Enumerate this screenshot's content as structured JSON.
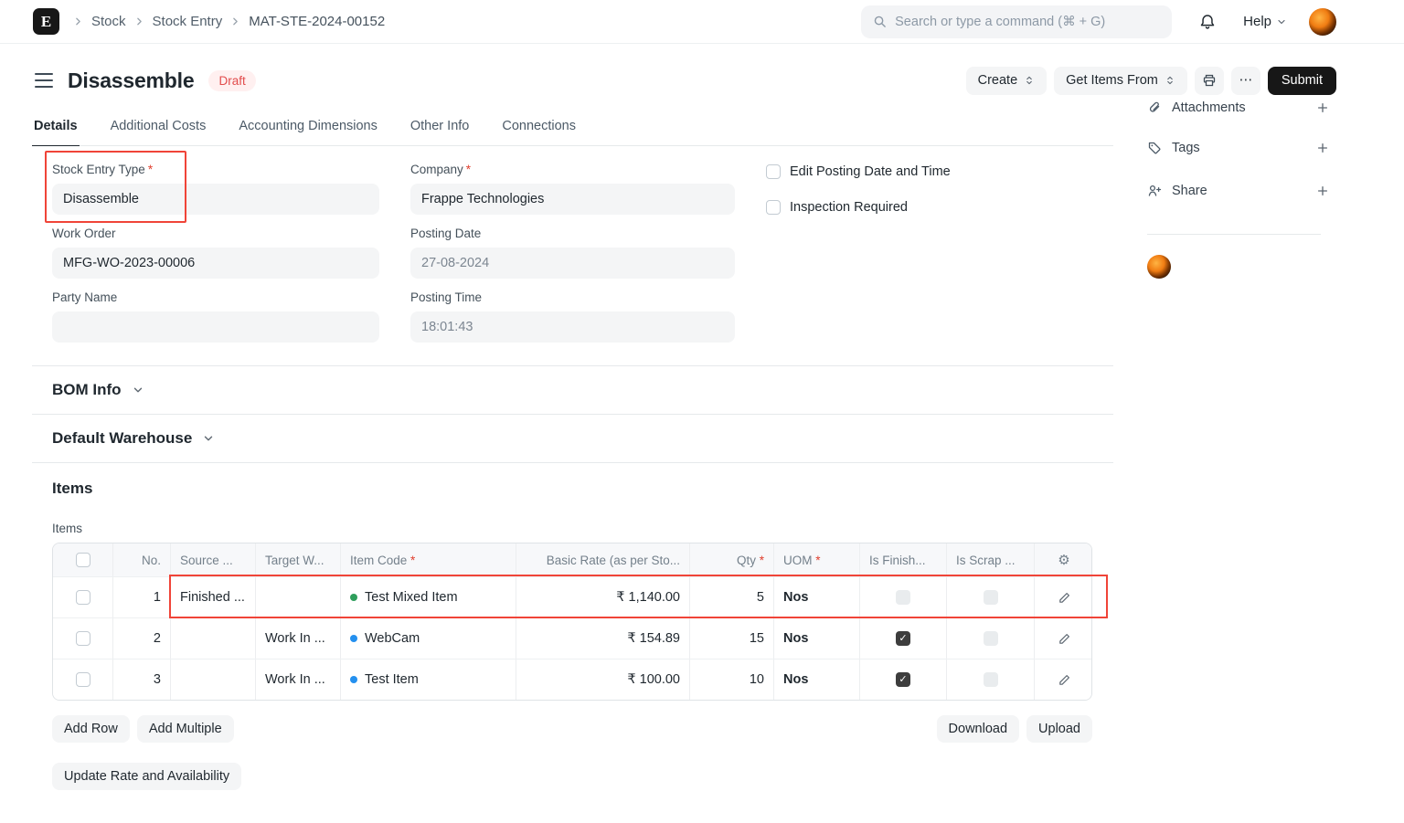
{
  "colors": {
    "annotation_red": "#f04438",
    "required_red": "#e03e2d",
    "draft_text": "#e24c4c",
    "draft_bg": "#fff0f0",
    "submit_bg": "#171717",
    "item_dot_green": "#2e9e5b",
    "item_dot_blue": "#2490ef"
  },
  "navbar": {
    "logo_letter": "E",
    "breadcrumbs": [
      "Stock",
      "Stock Entry",
      "MAT-STE-2024-00152"
    ],
    "search_placeholder": "Search or type a command (⌘ + G)",
    "help_label": "Help"
  },
  "header": {
    "title": "Disassemble",
    "status": "Draft",
    "create_button": "Create",
    "get_items_from_button": "Get Items From",
    "more_button": "⋯",
    "submit_button": "Submit"
  },
  "tabs": [
    {
      "label": "Details",
      "active": true
    },
    {
      "label": "Additional Costs",
      "active": false
    },
    {
      "label": "Accounting Dimensions",
      "active": false
    },
    {
      "label": "Other Info",
      "active": false
    },
    {
      "label": "Connections",
      "active": false
    }
  ],
  "form": {
    "stock_entry_type": {
      "label": "Stock Entry Type",
      "required": true,
      "value": "Disassemble"
    },
    "work_order": {
      "label": "Work Order",
      "value": "MFG-WO-2023-00006"
    },
    "party_name": {
      "label": "Party Name",
      "value": ""
    },
    "company": {
      "label": "Company",
      "required": true,
      "value": "Frappe Technologies"
    },
    "posting_date": {
      "label": "Posting Date",
      "value": "27-08-2024"
    },
    "posting_time": {
      "label": "Posting Time",
      "value": "18:01:43"
    },
    "edit_posting_checkbox": {
      "label": "Edit Posting Date and Time",
      "checked": false
    },
    "inspection_checkbox": {
      "label": "Inspection Required",
      "checked": false
    }
  },
  "sections": {
    "bom_info": "BOM Info",
    "default_warehouse": "Default Warehouse",
    "items_heading": "Items",
    "items_field_label": "Items"
  },
  "items_table": {
    "columns": [
      {
        "label": "No.",
        "required": false
      },
      {
        "label": "Source ...",
        "required": false
      },
      {
        "label": "Target W...",
        "required": false
      },
      {
        "label": "Item Code",
        "required": true
      },
      {
        "label": "Basic Rate (as per Sto...",
        "required": false
      },
      {
        "label": "Qty",
        "required": true
      },
      {
        "label": "UOM",
        "required": true
      },
      {
        "label": "Is Finish...",
        "required": false
      },
      {
        "label": "Is Scrap ...",
        "required": false
      }
    ],
    "rows": [
      {
        "no": "1",
        "source_warehouse": "Finished ...",
        "target_warehouse": "",
        "item_code": "Test Mixed Item",
        "dot": "green",
        "basic_rate": "₹ 1,140.00",
        "qty": "5",
        "uom": "Nos",
        "is_finished_item": false,
        "is_scrap_item": false,
        "highlighted": true
      },
      {
        "no": "2",
        "source_warehouse": "",
        "target_warehouse": "Work In ...",
        "item_code": "WebCam",
        "dot": "blue",
        "basic_rate": "₹ 154.89",
        "qty": "15",
        "uom": "Nos",
        "is_finished_item": true,
        "is_scrap_item": false,
        "highlighted": false
      },
      {
        "no": "3",
        "source_warehouse": "",
        "target_warehouse": "Work In ...",
        "item_code": "Test Item",
        "dot": "blue",
        "basic_rate": "₹ 100.00",
        "qty": "10",
        "uom": "Nos",
        "is_finished_item": true,
        "is_scrap_item": false,
        "highlighted": false
      }
    ]
  },
  "table_buttons": {
    "add_row": "Add Row",
    "add_multiple": "Add Multiple",
    "download": "Download",
    "upload": "Upload"
  },
  "update_rate_button": "Update Rate and Availability",
  "sidebar": {
    "items": [
      {
        "label": "Attachments"
      },
      {
        "label": "Tags"
      },
      {
        "label": "Share"
      }
    ]
  },
  "misc": {
    "required_marker": "*",
    "check_glyph": "✓",
    "gear_glyph": "⚙"
  }
}
